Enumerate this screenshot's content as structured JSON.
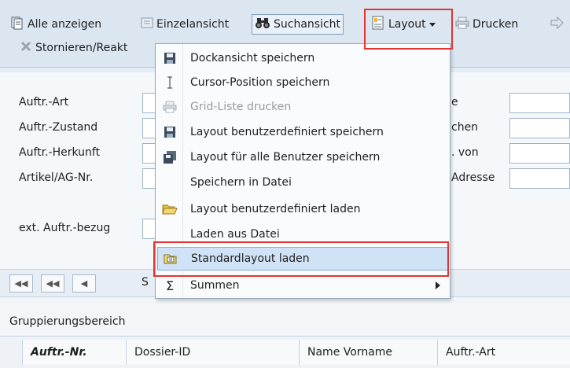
{
  "toolbar": {
    "show_all": "Alle anzeigen",
    "single_view": "Einzelansicht",
    "search_view": "Suchansicht",
    "layout": "Layout",
    "print": "Drucken",
    "cancel_reactivate": "Stornieren/Reakt"
  },
  "form": {
    "labels": [
      "Auftr.-Art",
      "Auftr.-Zustand",
      "Auftr.-Herkunft",
      "Artikel/AG-Nr.",
      "ext. Auftr.-bezug"
    ],
    "right_labels": [
      "e",
      "chen",
      ". von",
      "Adresse"
    ]
  },
  "layout_menu": {
    "items": [
      {
        "label": "Dockansicht speichern",
        "icon": "floppy-icon",
        "disabled": false
      },
      {
        "label": "Cursor-Position speichern",
        "icon": "text-cursor-icon",
        "disabled": false
      },
      {
        "label": "Grid-Liste drucken",
        "icon": "printer-icon",
        "disabled": true
      },
      {
        "label": "Layout benutzerdefiniert speichern",
        "icon": "floppy-icon",
        "disabled": false
      },
      {
        "label": "Layout für alle Benutzer speichern",
        "icon": "multi-floppy-icon",
        "disabled": false
      },
      {
        "label": "Speichern in Datei",
        "icon": "",
        "disabled": false
      },
      {
        "label": "Layout benutzerdefiniert laden",
        "icon": "open-folder-icon",
        "disabled": false
      },
      {
        "label": "Laden aus Datei",
        "icon": "",
        "disabled": false
      },
      {
        "label": "Standardlayout laden",
        "icon": "load-layout-icon",
        "disabled": false,
        "highlighted": true
      },
      {
        "label": "Summen",
        "icon": "sigma-icon",
        "disabled": false,
        "submenu": true
      }
    ]
  },
  "pager": {
    "label_partial": "S"
  },
  "grid": {
    "group_area": "Gruppierungsbereich",
    "columns": [
      "Auftr.-Nr.",
      "Dossier-ID",
      "Name Vorname",
      "Auftr.-Art"
    ]
  },
  "colors": {
    "highlight_red": "#e3342f",
    "menu_hover": "#d0e3f6",
    "toolbar_bg": "#dbe6f1"
  }
}
